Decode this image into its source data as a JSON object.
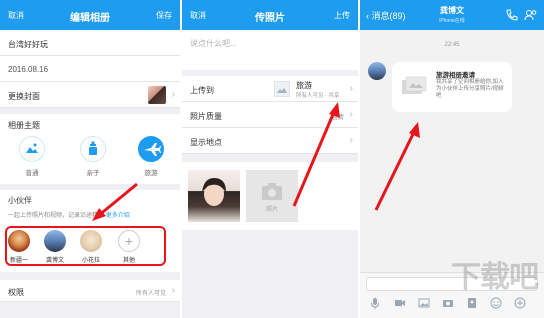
{
  "panel1": {
    "nav": {
      "cancel": "取消",
      "title": "编辑相册",
      "save": "保存"
    },
    "album_name": "台湾好好玩",
    "date": "2016.08.16",
    "cover_label": "更换封面",
    "theme_section": "相册主题",
    "themes": [
      {
        "label": "普通",
        "icon": "landscape-icon"
      },
      {
        "label": "亲子",
        "icon": "baby-bottle-icon"
      },
      {
        "label": "旅游",
        "icon": "airplane-icon",
        "selected": true
      }
    ],
    "partners_title": "小伙伴",
    "partners_desc": "一起上传照片和视频，记录沿途精彩",
    "partners_more": "更多介绍",
    "friends": [
      {
        "name": "新疆一"
      },
      {
        "name": "龚博文"
      },
      {
        "name": "小花拉"
      },
      {
        "name": "其他"
      }
    ],
    "permission_label": "权限",
    "permission_value": "所有人可见"
  },
  "panel2": {
    "nav": {
      "cancel": "取消",
      "title": "传照片",
      "upload": "上传"
    },
    "caption_placeholder": "说点什么吧...",
    "upload_to_label": "上传到",
    "upload_to_value": "旅游",
    "upload_to_sub": "所有人可见 · 共享",
    "quality_label": "照片质量",
    "quality_value": "高清",
    "location_label": "显示地点",
    "add_photo_label": "照片"
  },
  "panel3": {
    "nav": {
      "back": "消息(89)",
      "contact_name": "龚博文",
      "contact_sub": "iPhone在线"
    },
    "time": "22:45",
    "card_title": "旅游相册邀请",
    "card_body": "我共享了空间相册给你,加入为小伙伴上传分享照片/视频吧",
    "watermark": "下载吧"
  },
  "colors": {
    "brand_blue": "#1e9cf0",
    "highlight_red": "#e8161c"
  }
}
